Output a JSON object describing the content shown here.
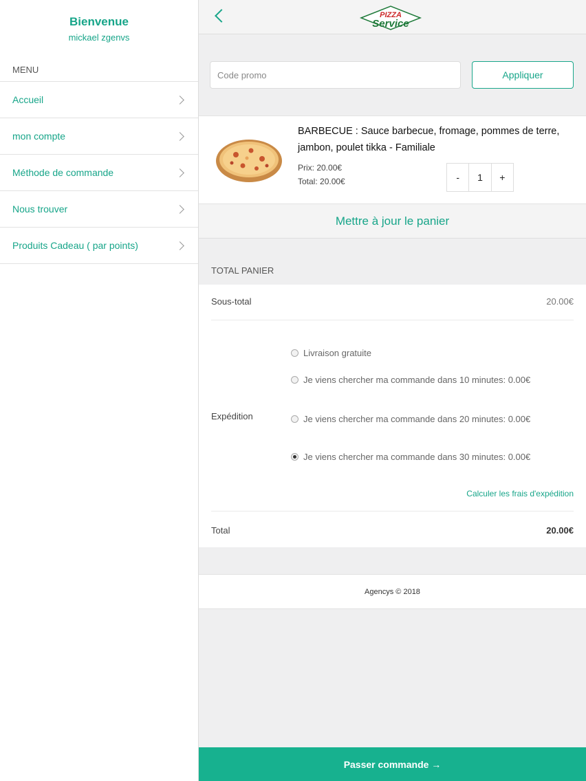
{
  "sidebar": {
    "welcome_title": "Bienvenue",
    "username": "mickael zgenvs",
    "menu_label": "MENU",
    "items": [
      {
        "label": "Accueil"
      },
      {
        "label": "mon compte"
      },
      {
        "label": "Méthode de commande"
      },
      {
        "label": "Nous trouver"
      },
      {
        "label": "Produits Cadeau ( par points)"
      }
    ]
  },
  "header": {
    "back_icon": "chevron-left-icon",
    "logo_top": "PIZZA",
    "logo_bottom": "Service"
  },
  "promo": {
    "placeholder": "Code promo",
    "value": "",
    "apply_label": "Appliquer"
  },
  "cart": {
    "items": [
      {
        "name": "BARBECUE :  Sauce barbecue, fromage, pommes de terre, jambon, poulet tikka - Familiale",
        "price": "Prix: 20.00€",
        "total": "Total: 20.00€",
        "qty_minus": "-",
        "quantity": "1",
        "qty_plus": "+"
      }
    ],
    "update_label": "Mettre à jour le panier"
  },
  "totals": {
    "heading": "TOTAL PANIER",
    "subtotal_label": "Sous-total",
    "subtotal_value": "20.00€",
    "shipping_label": "Expédition",
    "shipping_options": [
      {
        "label": "Livraison gratuite",
        "selected": false
      },
      {
        "label": "Je viens chercher ma commande dans 10 minutes: 0.00€",
        "selected": false
      },
      {
        "label": "Je viens chercher ma commande dans 20 minutes: 0.00€",
        "selected": false
      },
      {
        "label": "Je viens chercher ma commande dans 30 minutes: 0.00€",
        "selected": true
      }
    ],
    "calc_link": "Calculer les frais d'expédition",
    "total_label": "Total",
    "total_value": "20.00€"
  },
  "footer": {
    "copyright": "Agencys © 2018"
  },
  "checkout": {
    "label": "Passer commande →"
  },
  "colors": {
    "accent": "#17a589",
    "checkout_bg": "#17b18f",
    "logo_red": "#cc2a2a",
    "logo_green": "#1f7a3a"
  }
}
